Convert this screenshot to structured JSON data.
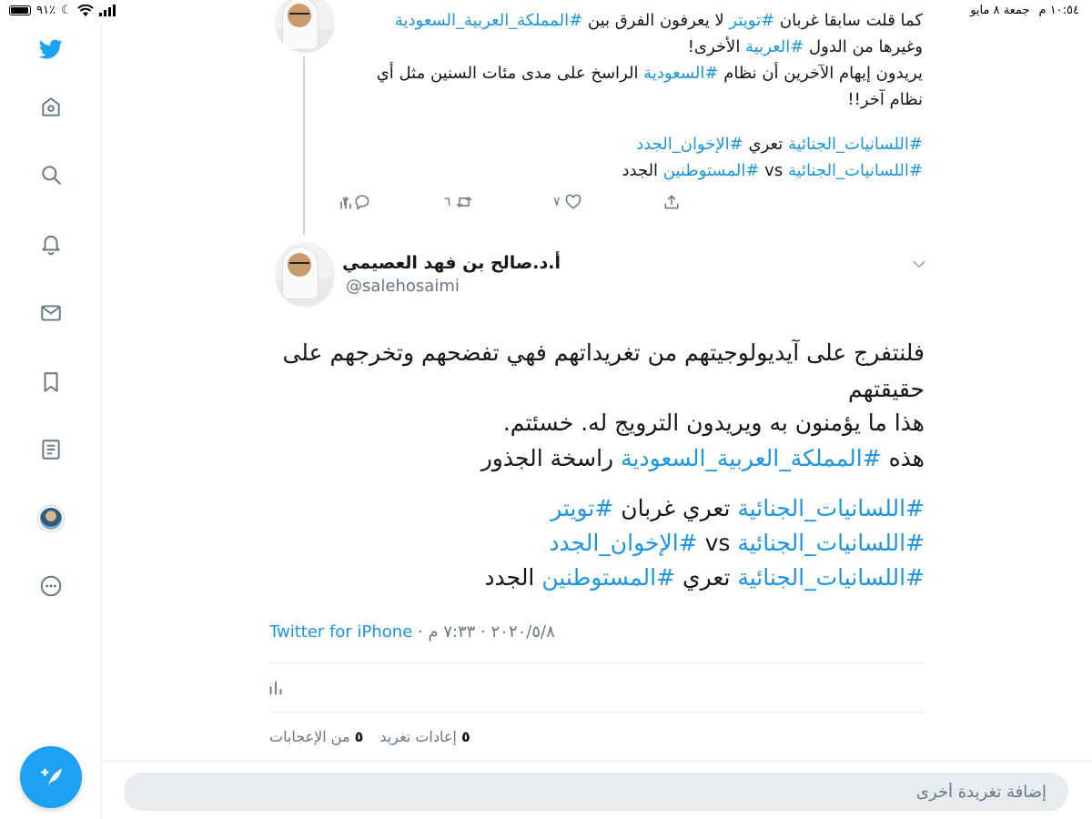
{
  "status_bar": {
    "time": "١٠:٥٤ م",
    "date": "جمعة ٨ مايو",
    "battery": "٩١٪"
  },
  "sidebar": {
    "items": [
      {
        "name": "twitter-logo-icon"
      },
      {
        "name": "home-icon"
      },
      {
        "name": "search-icon"
      },
      {
        "name": "notifications-icon"
      },
      {
        "name": "messages-icon"
      },
      {
        "name": "bookmarks-icon"
      },
      {
        "name": "lists-icon"
      },
      {
        "name": "profile-avatar"
      },
      {
        "name": "more-icon"
      }
    ],
    "compose_icon": "compose-tweet-icon"
  },
  "previous_tweet": {
    "line1": "كما قلت سابقا غربان #تويتر لا يعرفون الفرق بين #المملكة_العربية_السعودية",
    "line2": "وغيرها من الدول #العربية الأخرى!",
    "line3": "يريدون إيهام الآخرين أن نظام #السعودية الراسخ على مدى مئات السنين مثل أي",
    "line4": "نظام آخر!!",
    "line5": "#اللسانيات_الجنائية تعري #الإخوان_الجدد",
    "line6": "#اللسانيات_الجنائية vs #المستوطنين الجدد",
    "reply_count": "٢",
    "retweet_count": "٦",
    "like_count": "٧"
  },
  "tweet": {
    "author_name": "أ.د.صالح بن فهد العصيمي",
    "author_handle": "@salehosaimi",
    "lines": [
      "فلنتفرج على آيديولوجيتهم من تغريداتهم فهي تفضحهم وتخرجهم على",
      "حقيقتهم",
      "هذا ما يؤمنون به ويريدون الترويج له. خسئتم.",
      "هذه #المملكة_العربية_السعودية راسخة الجذور",
      "#اللسانيات_الجنائية تعري غربان #تويتر",
      "#اللسانيات_الجنائية vs #الإخوان_الجدد",
      "#اللسانيات_الجنائية تعري #المستوطنين الجدد"
    ],
    "time": "٧:٣٣ م",
    "date": "٢٠٢٠/٥/٨",
    "source": "Twitter for iPhone",
    "retweets_count": "٥",
    "retweets_label": "إعادات تغريد",
    "likes_count": "٥",
    "likes_label": "من الإعجابات"
  },
  "reply": {
    "placeholder": "إضافة تغريدة أخرى"
  },
  "colors": {
    "accent": "#1da1f2",
    "hashtag": "#1b95e0",
    "muted": "#657786",
    "divider": "#e6ecf0"
  }
}
